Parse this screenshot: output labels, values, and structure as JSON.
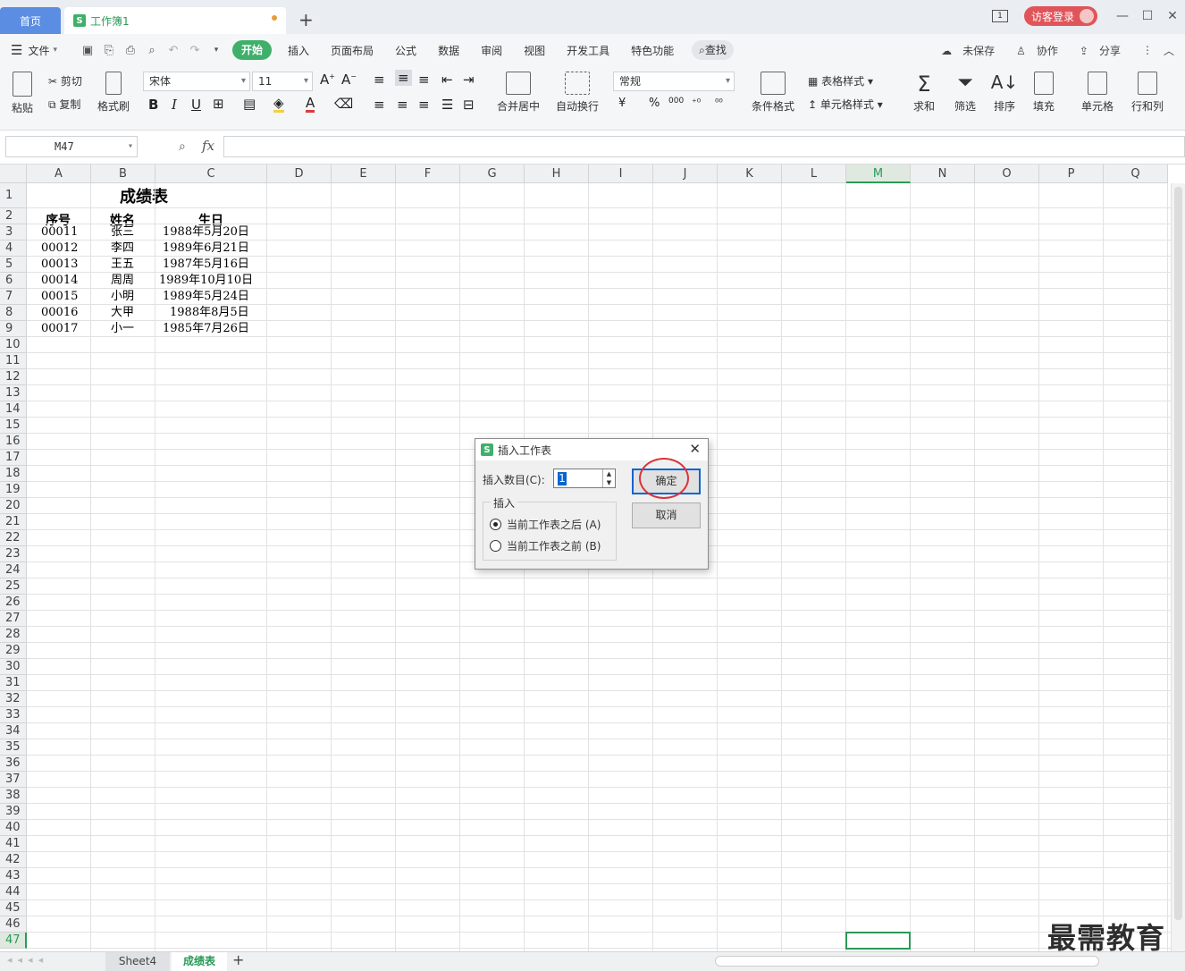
{
  "tabs": {
    "home": "首页",
    "workbook": "工作簿1",
    "workbook_logo": "S",
    "add": "+"
  },
  "window": {
    "login_label": "访客登录",
    "layout_label": "1"
  },
  "menu": {
    "file": "文件",
    "items": [
      "开始",
      "插入",
      "页面布局",
      "公式",
      "数据",
      "审阅",
      "视图",
      "开发工具",
      "特色功能"
    ],
    "search": "查找",
    "right": [
      "未保存",
      "协作",
      "分享"
    ]
  },
  "ribbon": {
    "paste": "粘贴",
    "cut": "剪切",
    "copy": "复制",
    "format_painter": "格式刷",
    "font_name": "宋体",
    "font_size": "11",
    "bold": "B",
    "italic": "I",
    "underline": "U",
    "merge_center": "合并居中",
    "wrap_text": "自动换行",
    "number_format": "常规",
    "currency": "¥",
    "percent": "%",
    "thousands": "000",
    "cond_format": "条件格式",
    "table_style": "表格样式",
    "cell_style": "单元格样式",
    "sum": "求和",
    "filter": "筛选",
    "sort": "排序",
    "fill": "填充",
    "cell": "单元格",
    "row_col": "行和列"
  },
  "formula_bar": {
    "name_box": "M47",
    "fx": "fx",
    "formula": ""
  },
  "grid": {
    "columns": [
      "A",
      "B",
      "C",
      "D",
      "E",
      "F",
      "G",
      "H",
      "I",
      "J",
      "K",
      "L",
      "M",
      "N",
      "O",
      "P",
      "Q"
    ],
    "selected_column": "M",
    "rows": [
      "1",
      "2",
      "3",
      "4",
      "5",
      "6",
      "7",
      "8",
      "9",
      "10",
      "11",
      "12",
      "13",
      "14",
      "15",
      "16",
      "17",
      "18",
      "19",
      "20",
      "21",
      "22",
      "23",
      "24",
      "25",
      "26",
      "27",
      "28",
      "29",
      "30",
      "31",
      "32",
      "33",
      "34",
      "35",
      "36",
      "37",
      "38",
      "39",
      "40",
      "41",
      "42",
      "43",
      "44",
      "45",
      "46",
      "47"
    ],
    "selected_row": "47",
    "title": "成绩表",
    "headers": [
      "序号",
      "姓名",
      "生日"
    ],
    "records": [
      [
        "00011",
        "张三",
        "1988年5月20日"
      ],
      [
        "00012",
        "李四",
        "1989年6月21日"
      ],
      [
        "00013",
        "王五",
        "1987年5月16日"
      ],
      [
        "00014",
        "周周",
        "1989年10月10日"
      ],
      [
        "00015",
        "小明",
        "1989年5月24日"
      ],
      [
        "00016",
        "大甲",
        "1988年8月5日"
      ],
      [
        "00017",
        "小一",
        "1985年7月26日"
      ]
    ]
  },
  "sheets": {
    "tabs": [
      "Sheet4",
      "成绩表"
    ],
    "active": "成绩表",
    "add": "+"
  },
  "dialog": {
    "title": "插入工作表",
    "count_label": "插入数目(C):",
    "count_value": "1",
    "group_label": "插入",
    "option_after": "当前工作表之后 (A)",
    "option_before": "当前工作表之前 (B)",
    "selected_option": "after",
    "ok": "确定",
    "cancel": "取消"
  },
  "watermark": "最需教育",
  "colors": {
    "accent": "#3fb06a",
    "home_tab": "#5b8de2",
    "login": "#e0555a",
    "annotation": "#d9343a"
  }
}
